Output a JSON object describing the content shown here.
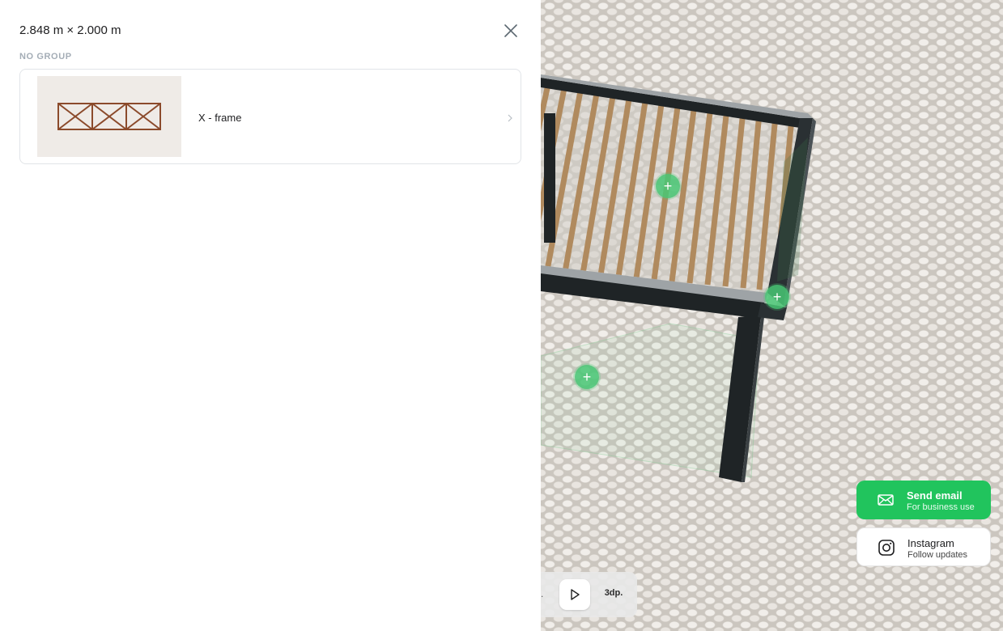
{
  "panel": {
    "title": "2.848 m × 2.000 m",
    "close_icon": "close-icon",
    "group_label": "NO GROUP",
    "items": [
      {
        "label": "X - frame",
        "thumbnail": "x-frame-railing-thumbnail",
        "chevron_icon": "chevron-right-icon"
      }
    ]
  },
  "scene": {
    "hotspots": [
      "+",
      "+",
      "+"
    ],
    "hotspot_icon": "plus-icon"
  },
  "toolbar": {
    "partial_label": ".",
    "play_icon": "play-icon",
    "view_label": "3dp."
  },
  "contact": {
    "email": {
      "title": "Send email",
      "subtitle": "For business use",
      "icon": "mail-icon"
    },
    "instagram": {
      "title": "Instagram",
      "subtitle": "Follow updates",
      "icon": "instagram-icon"
    }
  },
  "colors": {
    "accent_green": "#21c45d",
    "frame_dark": "#1f2426",
    "slat_wood": "#b08a5e",
    "railing_brown": "#8b4a2b"
  }
}
